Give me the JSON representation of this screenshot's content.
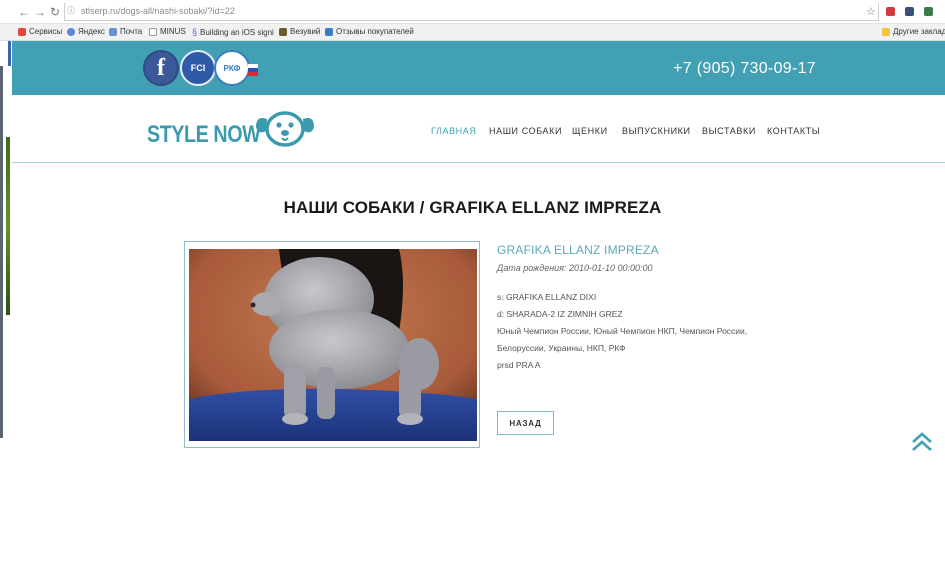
{
  "browser": {
    "url": "stlserp.ru/dogs-all/nashi-sobaki/?id=22",
    "bookmarks": [
      "Сервисы",
      "Яндекс",
      "Почта",
      "MINUS",
      "Building an iOS signi",
      "Везувий",
      "Отзывы покупателей"
    ],
    "other_bookmarks": "Другие закладки",
    "icons": [
      "back-arrow-icon",
      "forward-arrow-icon",
      "reload-icon",
      "info-icon",
      "star-icon"
    ]
  },
  "topbar": {
    "phone": "+7 (905) 730-09-17",
    "social": {
      "facebook": "f",
      "fci": "FCI",
      "rkf": "РКФ"
    },
    "colors": {
      "bar": "#42a0b4",
      "facebook": "#3b5998"
    }
  },
  "header": {
    "logo": "STYLE NOW",
    "menu": [
      "ГЛАВНАЯ",
      "НАШИ СОБАКИ",
      "ЩЕНКИ",
      "ВЫПУСКНИКИ",
      "ВЫСТАВКИ",
      "КОНТАКТЫ"
    ],
    "active_menu_index": 0
  },
  "page": {
    "heading": "НАШИ СОБАКИ / GRAFIKA ELLANZ IMPREZA",
    "dog": {
      "name": "GRAFIKA ELLANZ IMPREZA",
      "dob": "Дата рождения: 2010-01-10 00:00:00",
      "sire": "s: GRAFIKA ELLANZ DIXI",
      "dam": "d: SHARADA-2 IZ ZIMNIH GREZ",
      "titles_line1": "Юный Чемпион России, Юный Чемпион НКП, Чемпион России,",
      "titles_line2": "Белоруссии, Украины, НКП, РКФ",
      "health": "prsd PRA A"
    },
    "back_button": "НАЗАД"
  },
  "accent_color": "#42a0b4"
}
